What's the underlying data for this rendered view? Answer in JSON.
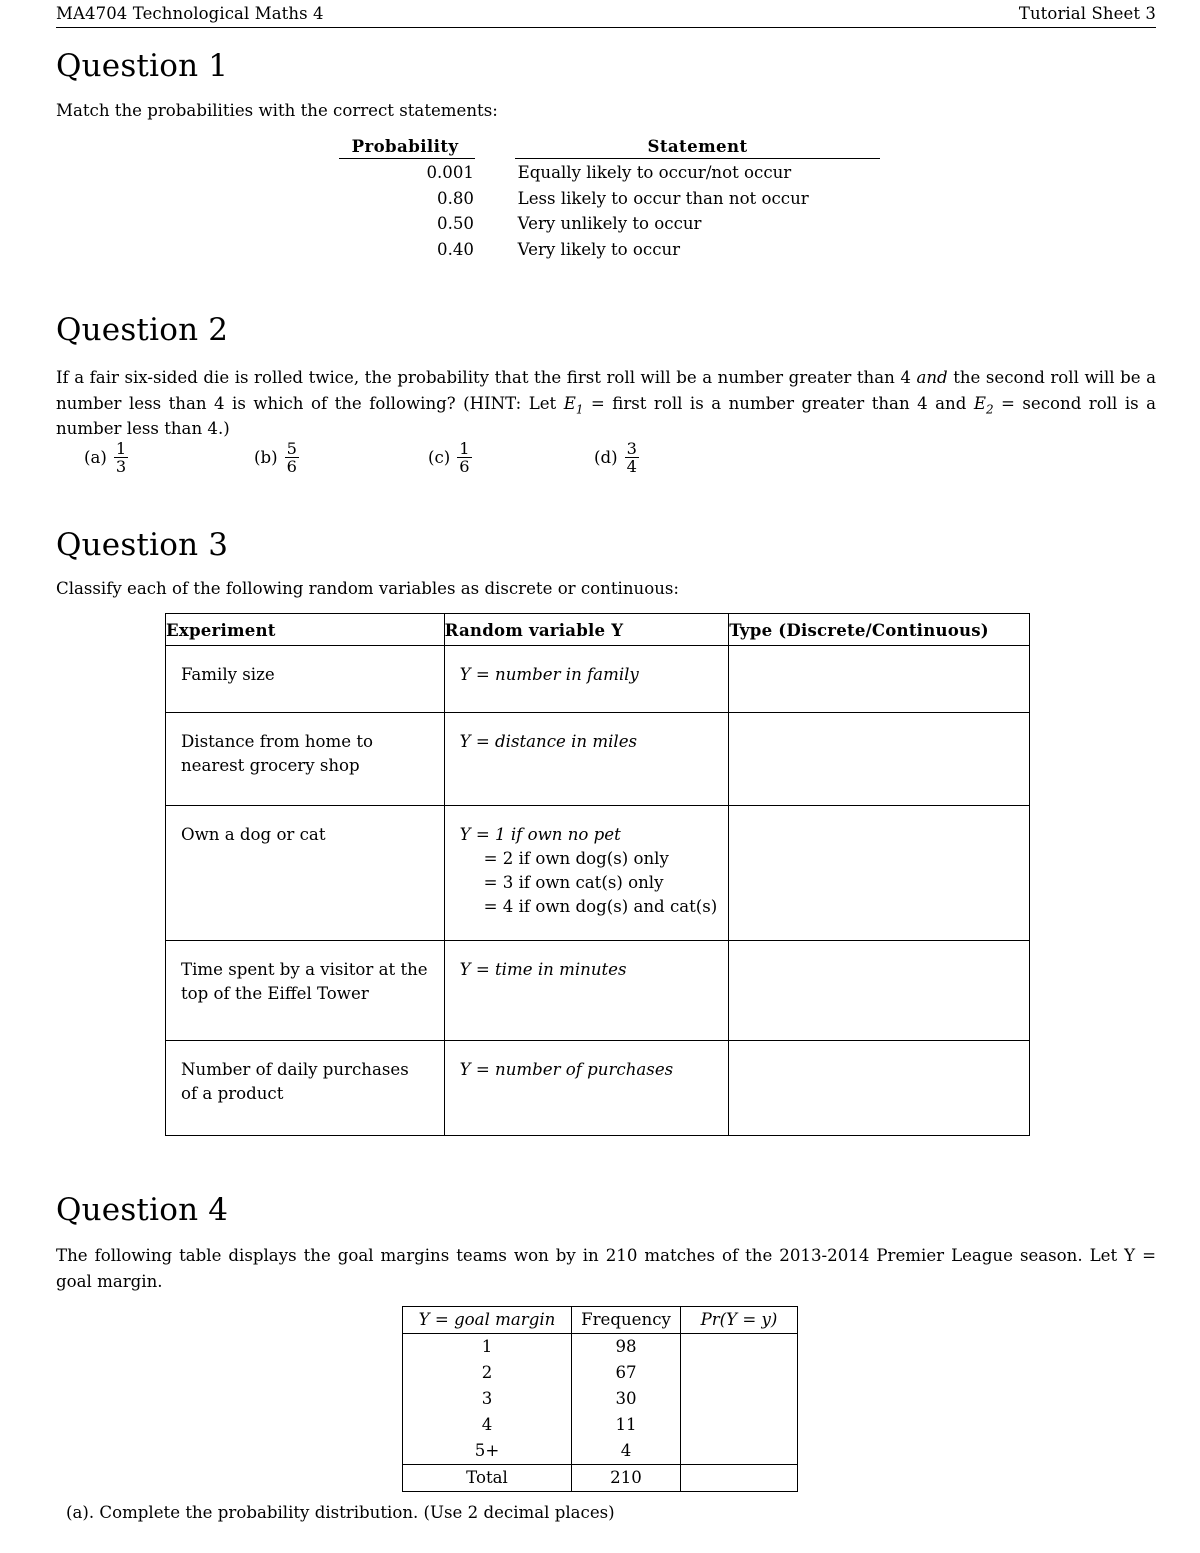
{
  "header": {
    "left": "MA4704 Technological Maths 4",
    "right": "Tutorial Sheet 3"
  },
  "q1": {
    "heading": "Question 1",
    "prompt": "Match the probabilities with the correct statements:",
    "col_headers": [
      "Probability",
      "Statement"
    ],
    "rows": [
      {
        "probability": "0.001",
        "statement": "Equally likely to occur/not occur"
      },
      {
        "probability": "0.80",
        "statement": "Less likely to occur than not occur"
      },
      {
        "probability": "0.50",
        "statement": "Very unlikely to occur"
      },
      {
        "probability": "0.40",
        "statement": "Very likely to occur"
      }
    ]
  },
  "q2": {
    "heading": "Question 2",
    "body_line1": "If a fair six-sided die is rolled twice, the probability that the first roll will be a number greater than 4 ",
    "body_and": "and",
    "body_line2": " the second roll will be a number less than 4 is which of the following? (HINT: Let ",
    "e1": "E",
    "e1sub": "1",
    "body_line3": " = first roll is a number greater than 4 and ",
    "e2": "E",
    "e2sub": "2",
    "body_line4": " = second roll is a number less than 4.)",
    "options": [
      {
        "label": "(a)",
        "num": "1",
        "den": "3"
      },
      {
        "label": "(b)",
        "num": "5",
        "den": "6"
      },
      {
        "label": "(c)",
        "num": "1",
        "den": "6"
      },
      {
        "label": "(d)",
        "num": "3",
        "den": "4"
      }
    ]
  },
  "q3": {
    "heading": "Question 3",
    "prompt": "Classify each of the following random variables as discrete or continuous:",
    "col_headers": [
      "Experiment",
      "Random variable Y",
      "Type (Discrete/Continuous)"
    ],
    "rows": [
      {
        "experiment": "Family size",
        "variable": "Y  =  number in family",
        "variable_extra": [],
        "type": ""
      },
      {
        "experiment": "Distance from home to nearest grocery shop",
        "variable": "Y  =  distance in miles",
        "variable_extra": [],
        "type": ""
      },
      {
        "experiment": "Own a dog or cat",
        "variable": "Y  =  1 if own no pet",
        "variable_extra": [
          "=  2 if own dog(s) only",
          "=  3 if own cat(s) only",
          "=  4 if own dog(s) and cat(s)"
        ],
        "type": ""
      },
      {
        "experiment": "Time spent by a visitor at the top of the Eiffel Tower",
        "variable": "Y  =  time in minutes",
        "variable_extra": [],
        "type": ""
      },
      {
        "experiment": "Number of daily purchases of a product",
        "variable": "Y  =  number of purchases",
        "variable_extra": [],
        "type": ""
      }
    ]
  },
  "q4": {
    "heading": "Question 4",
    "body": "The following table displays the goal margins teams won by in 210 matches of the 2013-2014 Premier League season. Let Y = goal margin.",
    "table": {
      "col_headers": [
        "Y  =  goal margin",
        "Frequency",
        "Pr(Y = y)"
      ],
      "rows": [
        {
          "margin": "1",
          "frequency": "98",
          "prob": ""
        },
        {
          "margin": "2",
          "frequency": "67",
          "prob": ""
        },
        {
          "margin": "3",
          "frequency": "30",
          "prob": ""
        },
        {
          "margin": "4",
          "frequency": "11",
          "prob": ""
        },
        {
          "margin": "5+",
          "frequency": "4",
          "prob": ""
        }
      ],
      "total_label": "Total",
      "total_frequency": "210",
      "total_prob": ""
    },
    "part_a": "(a).  Complete the probability distribution.  (Use 2 decimal places)"
  }
}
